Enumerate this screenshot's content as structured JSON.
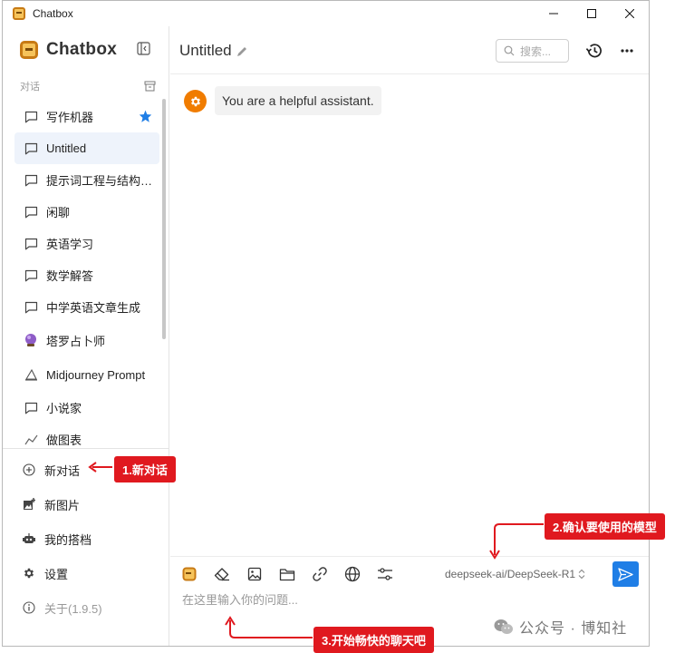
{
  "window": {
    "title": "Chatbox"
  },
  "sidebar": {
    "brand": "Chatbox",
    "section_label": "对话",
    "conversations": [
      {
        "label": "写作机器",
        "icon": "chat-bubble-icon",
        "starred": true
      },
      {
        "label": "Untitled",
        "icon": "chat-bubble-icon",
        "active": true
      },
      {
        "label": "提示词工程与结构…",
        "icon": "chat-bubble-icon"
      },
      {
        "label": "闲聊",
        "icon": "chat-bubble-icon"
      },
      {
        "label": "英语学习",
        "icon": "chat-bubble-icon"
      },
      {
        "label": "数学解答",
        "icon": "chat-bubble-icon"
      },
      {
        "label": "中学英语文章生成",
        "icon": "chat-bubble-icon"
      },
      {
        "label": "塔罗占卜师",
        "icon": "crystal-ball-icon"
      },
      {
        "label": "Midjourney Prompt",
        "icon": "sailboat-icon"
      },
      {
        "label": "小说家",
        "icon": "chat-bubble-icon"
      },
      {
        "label": "做图表",
        "icon": "chart-icon"
      }
    ],
    "menu": {
      "new_chat": "新对话",
      "new_image": "新图片",
      "my_partners": "我的搭档",
      "settings": "设置",
      "about": "关于(1.9.5)"
    }
  },
  "header": {
    "title": "Untitled",
    "search_placeholder": "搜索..."
  },
  "messages": [
    {
      "role": "system",
      "text": "You are a helpful assistant."
    }
  ],
  "composer": {
    "model": "deepseek-ai/DeepSeek-R1",
    "placeholder": "在这里输入你的问题..."
  },
  "annotations": {
    "step1": "1.新对话",
    "step2": "2.确认要使用的模型",
    "step3": "3.开始畅快的聊天吧"
  },
  "watermark": {
    "text": "公众号 · 博知社"
  },
  "colors": {
    "accent": "#1f7ee6",
    "callout": "#e0191f",
    "brand": "#f6c35a",
    "avatar": "#f07c00"
  }
}
